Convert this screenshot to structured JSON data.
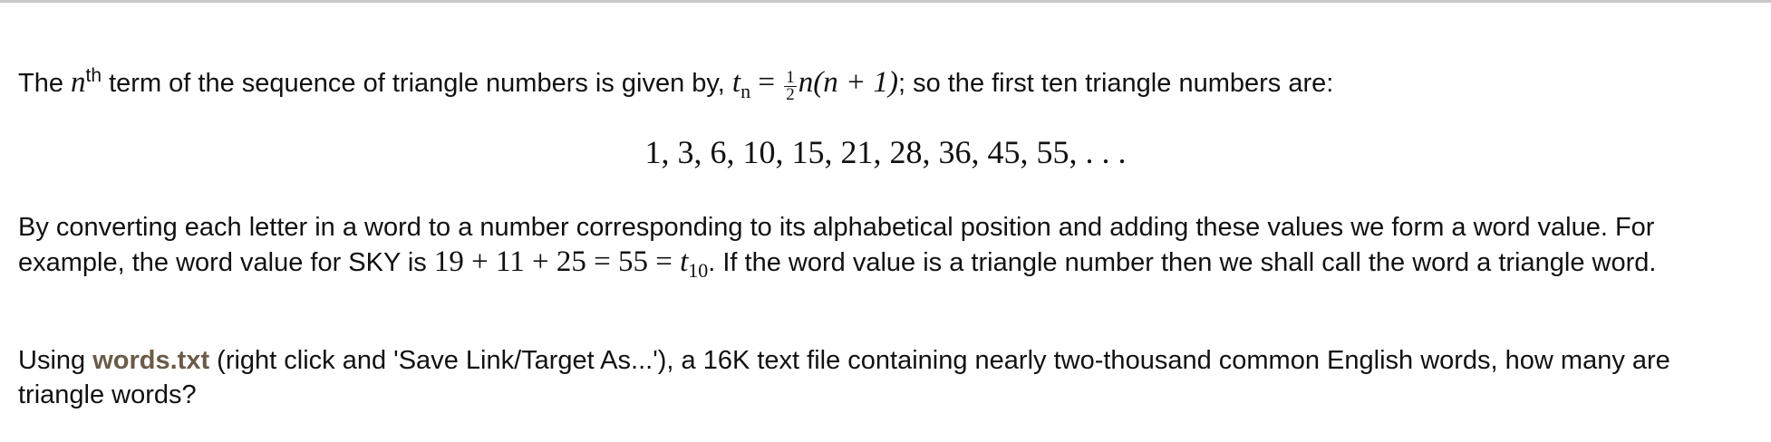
{
  "intro": {
    "the": "The",
    "n": "n",
    "th": "th",
    "text_after_th": " term of the sequence of triangle numbers is given by, ",
    "t": "t",
    "sub_n": "n",
    "equals": " = ",
    "frac_num": "1",
    "frac_den": "2",
    "formula_rest": "n(n + 1)",
    "text_after_formula": "; so the first ten triangle numbers are:"
  },
  "sequence": "1, 3, 6, 10, 15, 21, 28, 36, 45, 55, . . .",
  "paragraph2": {
    "text_before": "By converting each letter in a word to a number corresponding to its alphabetical position and adding these values we form a word value. For example, the word value for SKY is ",
    "math": "19 + 11 + 25 = 55 = ",
    "t": "t",
    "sub_10": "10",
    "text_after": ". If the word value is a triangle number then we shall call the word a triangle word."
  },
  "paragraph3": {
    "text_before": "Using ",
    "link_label": "words.txt",
    "text_after": " (right click and 'Save Link/Target As...'), a 16K text file containing nearly two-thousand common English words, how many are triangle words?"
  },
  "colors": {
    "text": "#111111",
    "link": "#6b5b48",
    "top_rule": "#c8c8c8"
  }
}
